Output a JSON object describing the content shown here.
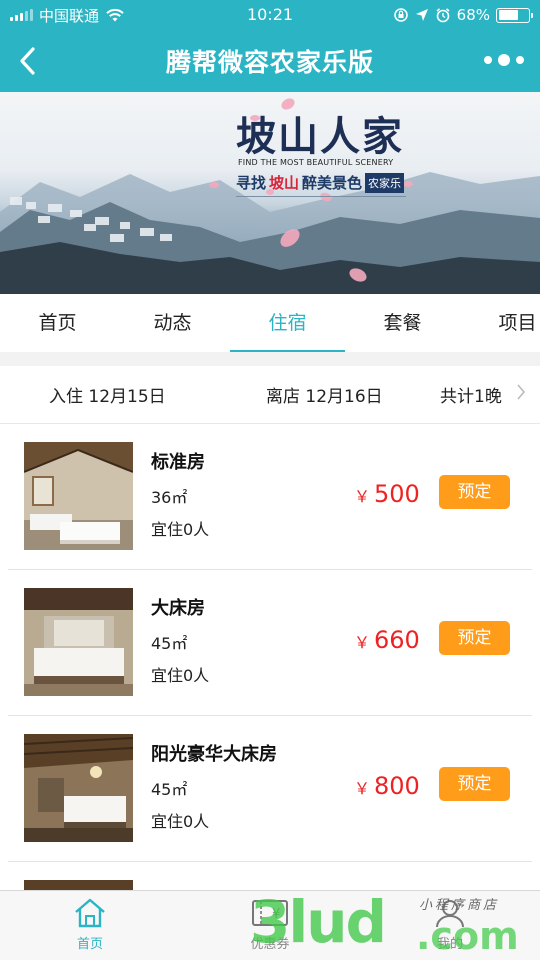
{
  "status_bar": {
    "carrier": "中国联通",
    "time": "10:21",
    "battery_text": "68%",
    "battery_level": 0.68
  },
  "header": {
    "title": "腾帮微容农家乐版",
    "back_icon": "chevron-left-icon",
    "more_icon": "more-dots-icon"
  },
  "banner": {
    "logo_text": "坡山人家",
    "english": "FIND THE MOST BEAUTIFUL SCENERY",
    "slogan_part1": "寻找",
    "slogan_highlight": "坡山",
    "slogan_part2": "醉美景色",
    "slogan_box": "农家乐"
  },
  "tabs": [
    {
      "label": "首页",
      "active": false
    },
    {
      "label": "动态",
      "active": false
    },
    {
      "label": "住宿",
      "active": true
    },
    {
      "label": "套餐",
      "active": false
    },
    {
      "label": "项目",
      "active": false
    }
  ],
  "dates": {
    "checkin": "入住 12月15日",
    "checkout": "离店 12月16日",
    "total": "共计1晚"
  },
  "rooms": [
    {
      "name": "标准房",
      "area": "36㎡",
      "capacity": "宜住0人",
      "currency": "￥",
      "price": "500",
      "book_label": "预定"
    },
    {
      "name": "大床房",
      "area": "45㎡",
      "capacity": "宜住0人",
      "currency": "￥",
      "price": "660",
      "book_label": "预定"
    },
    {
      "name": "阳光豪华大床房",
      "area": "45㎡",
      "capacity": "宜住0人",
      "currency": "￥",
      "price": "800",
      "book_label": "预定"
    }
  ],
  "tabbar": [
    {
      "label": "首页",
      "icon": "home-icon",
      "active": true
    },
    {
      "label": "优惠券",
      "icon": "coupon-icon",
      "active": false
    },
    {
      "label": "我的",
      "icon": "user-icon",
      "active": false
    }
  ],
  "watermark": {
    "big": "3lud",
    "com": ".com",
    "small": "小程序商店"
  },
  "colors": {
    "accent": "#2bb5c4",
    "price": "#ee2222",
    "book_button": "#ff9c1a"
  }
}
